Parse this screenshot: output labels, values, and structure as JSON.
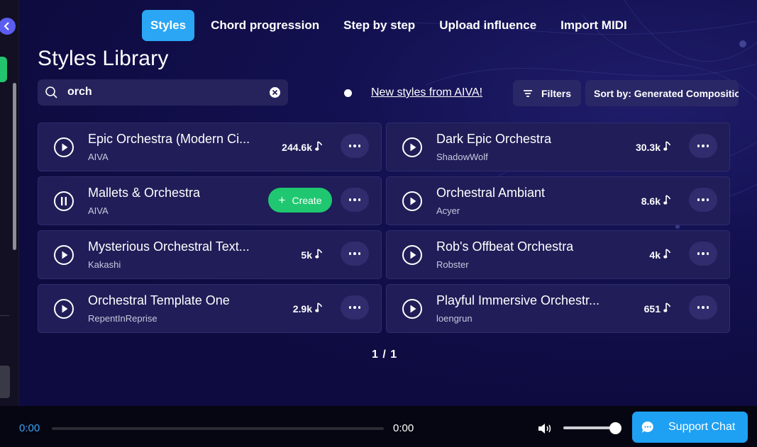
{
  "tabs": [
    "Styles",
    "Chord progression",
    "Step by step",
    "Upload influence",
    "Import MIDI"
  ],
  "page_title": "Styles Library",
  "search": {
    "value": "orch"
  },
  "new_styles_link": "New styles from AIVA!",
  "filters_label": "Filters",
  "sort_label": "Sort by: Generated Compositions",
  "create_label": "Create",
  "styles": [
    {
      "title": "Epic Orchestra (Modern Ci...",
      "author": "AIVA",
      "count": "244.6k",
      "state": "paused",
      "icon": "play-icon"
    },
    {
      "title": "Dark Epic Orchestra",
      "author": "ShadowWolf",
      "count": "30.3k",
      "state": "paused",
      "icon": "play-icon"
    },
    {
      "title": "Mallets & Orchestra",
      "author": "AIVA",
      "count": "",
      "state": "playing",
      "icon": "pause-icon"
    },
    {
      "title": "Orchestral Ambiant",
      "author": "Acyer",
      "count": "8.6k",
      "state": "paused",
      "icon": "play-icon"
    },
    {
      "title": "Mysterious Orchestral Text...",
      "author": "Kakashi",
      "count": "5k",
      "state": "paused",
      "icon": "play-icon"
    },
    {
      "title": "Rob's Offbeat Orchestra",
      "author": "Robster",
      "count": "4k",
      "state": "paused",
      "icon": "play-icon"
    },
    {
      "title": "Orchestral Template One",
      "author": "RepentInReprise",
      "count": "2.9k",
      "state": "paused",
      "icon": "play-icon"
    },
    {
      "title": "Playful Immersive Orchestr...",
      "author": "loengrun",
      "count": "651",
      "state": "paused",
      "icon": "play-icon"
    }
  ],
  "pagination": "1 / 1",
  "player": {
    "current_time": "0:00",
    "duration": "0:00",
    "volume": 0.95
  },
  "support_label": "Support Chat",
  "colors": {
    "accent": "#2aa6f5",
    "create": "#1fc870",
    "card": "#201d58",
    "background": "#0e0b40"
  }
}
